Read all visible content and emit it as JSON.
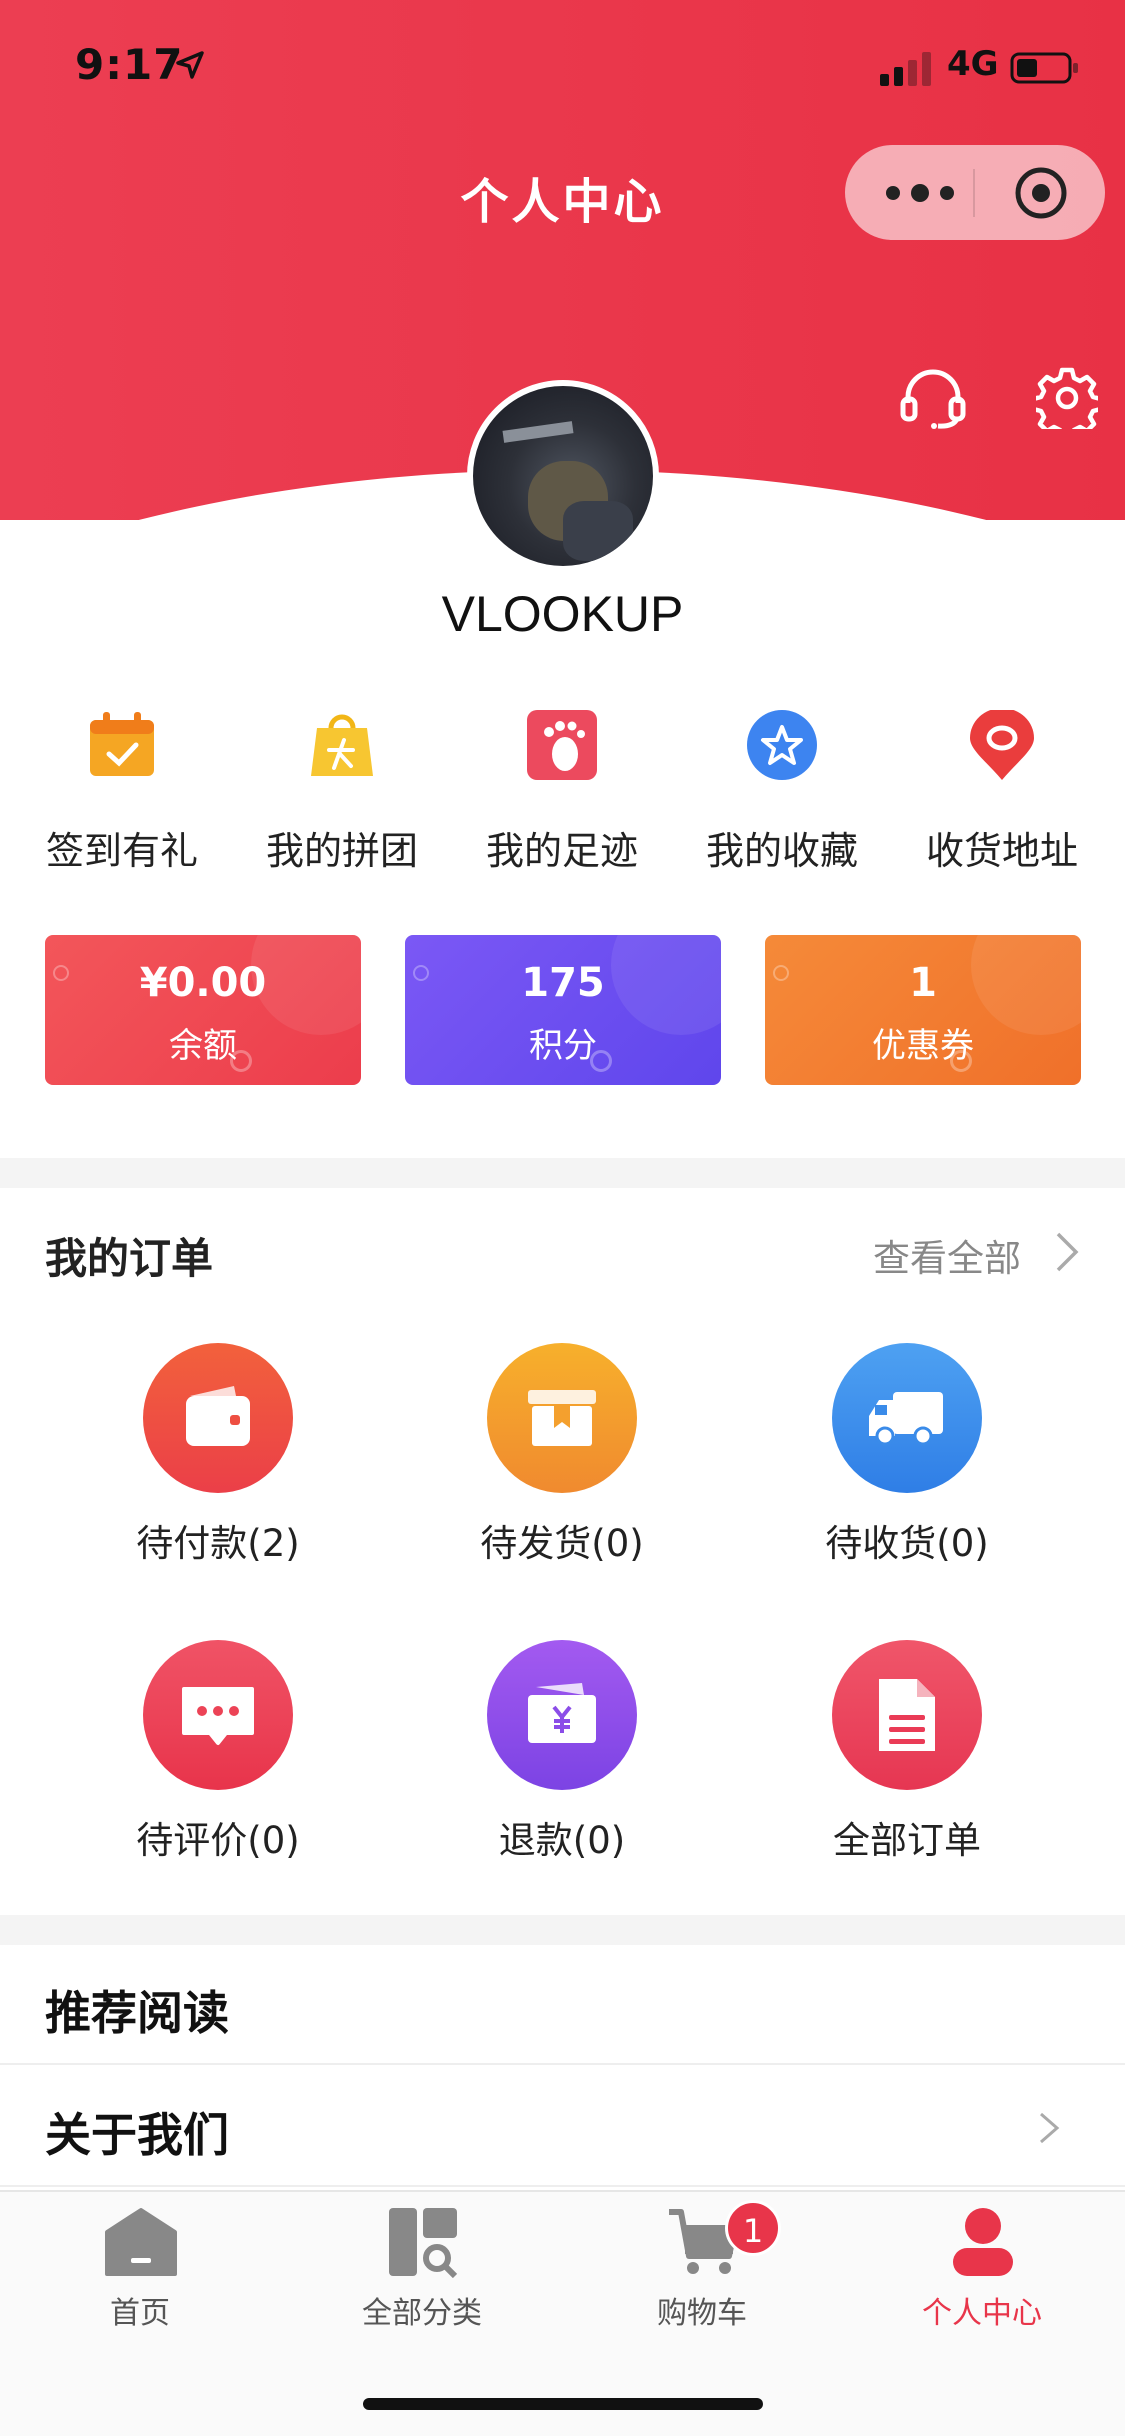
{
  "status_bar": {
    "time": "9:17",
    "network": "4G"
  },
  "header": {
    "title": "个人中心"
  },
  "profile": {
    "username": "VLOOKUP"
  },
  "quick_links": [
    {
      "label": "签到有礼",
      "icon": "calendar-check-icon"
    },
    {
      "label": "我的拼团",
      "icon": "shopping-bag-icon"
    },
    {
      "label": "我的足迹",
      "icon": "footprint-icon"
    },
    {
      "label": "我的收藏",
      "icon": "star-favorite-icon"
    },
    {
      "label": "收货地址",
      "icon": "location-pin-icon"
    }
  ],
  "stats": [
    {
      "value": "¥0.00",
      "label": "余额",
      "color": "#ef4652"
    },
    {
      "value": "175",
      "label": "积分",
      "color": "#6a4ff0"
    },
    {
      "value": "1",
      "label": "优惠券",
      "color": "#f27c33"
    }
  ],
  "orders": {
    "title": "我的订单",
    "see_all": "查看全部",
    "items": [
      {
        "label": "待付款(2)",
        "icon": "wallet-icon",
        "color": "#ef4b3f"
      },
      {
        "label": "待发货(0)",
        "icon": "box-icon",
        "color": "#f49a2f"
      },
      {
        "label": "待收货(0)",
        "icon": "truck-icon",
        "color": "#3b8ee9"
      },
      {
        "label": "待评价(0)",
        "icon": "comment-icon",
        "color": "#ec3f55"
      },
      {
        "label": "退款(0)",
        "icon": "refund-icon",
        "color": "#8b4de8"
      },
      {
        "label": "全部订单",
        "icon": "document-icon",
        "color": "#ea3b56"
      }
    ]
  },
  "menu": [
    {
      "label": "推荐阅读"
    },
    {
      "label": "关于我们"
    }
  ],
  "tabbar": {
    "items": [
      {
        "label": "首页",
        "icon": "home-icon"
      },
      {
        "label": "全部分类",
        "icon": "category-icon"
      },
      {
        "label": "购物车",
        "icon": "cart-icon"
      },
      {
        "label": "个人中心",
        "icon": "user-icon"
      }
    ],
    "cart_badge": "1",
    "active_color": "#e8354a"
  }
}
